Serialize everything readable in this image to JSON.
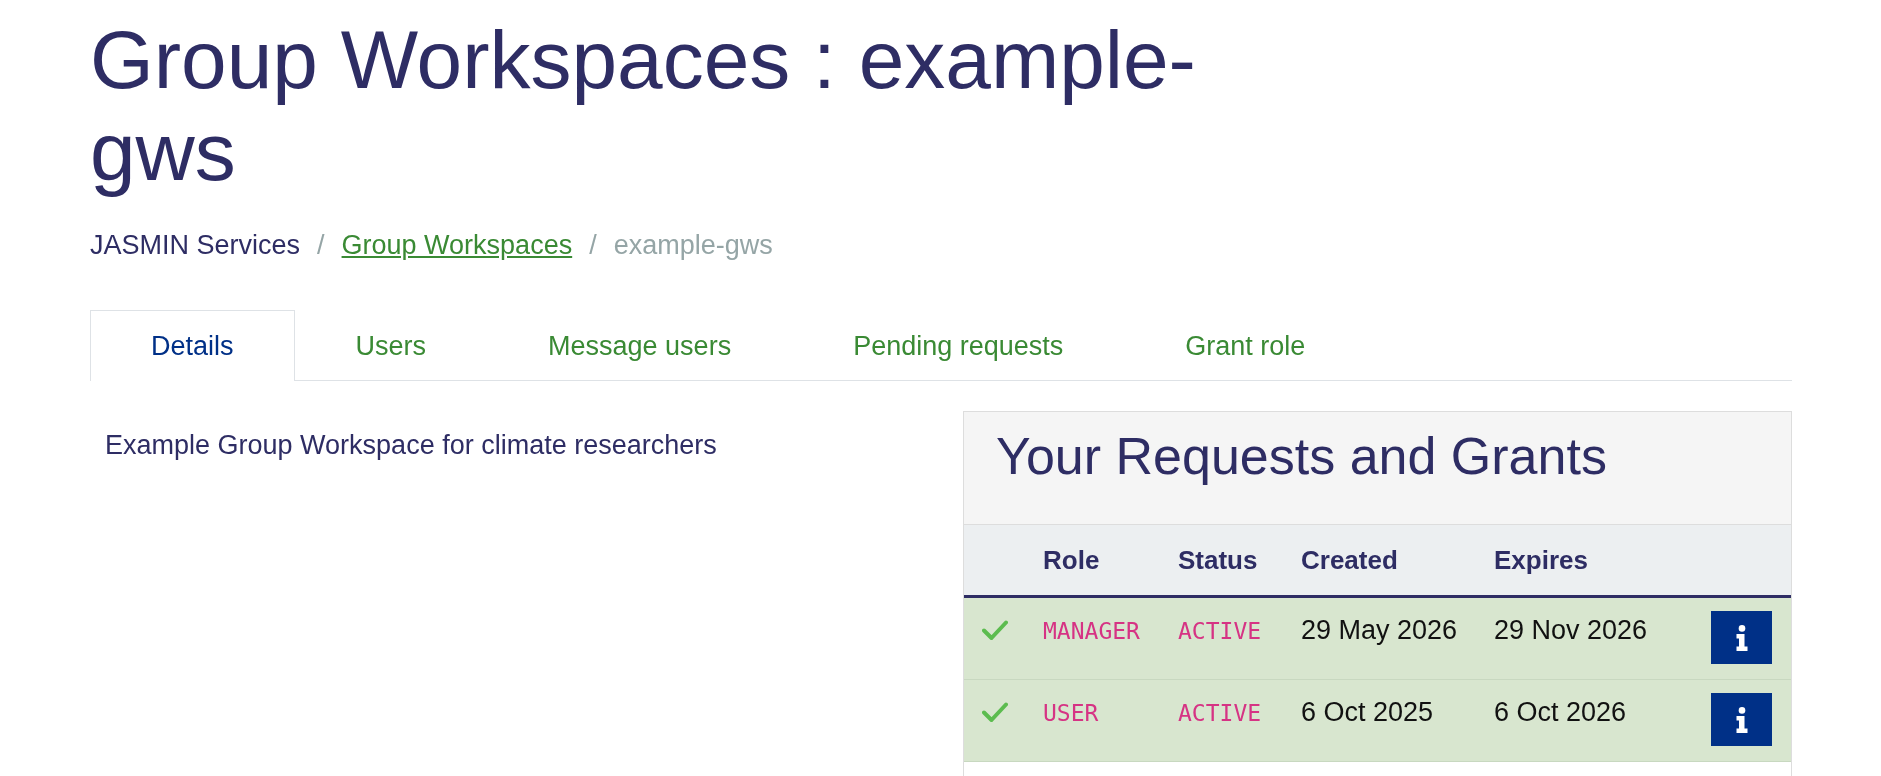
{
  "title": "Group Workspaces : example-gws",
  "breadcrumbs": [
    {
      "kind": "text",
      "label": "JASMIN Services"
    },
    {
      "kind": "separator",
      "label": "/"
    },
    {
      "kind": "link",
      "label": "Group Workspaces"
    },
    {
      "kind": "separator",
      "label": "/"
    },
    {
      "kind": "current",
      "label": "example-gws"
    }
  ],
  "tabs": [
    {
      "label": "Details",
      "selected": true
    },
    {
      "label": "Users",
      "selected": false
    },
    {
      "label": "Message users",
      "selected": false
    },
    {
      "label": "Pending requests",
      "selected": false
    },
    {
      "label": "Grant role",
      "selected": false
    }
  ],
  "description": "Example Group Workspace for climate researchers",
  "requests_panel": {
    "title": "Your Requests and Grants",
    "table": {
      "columns": [
        "Role",
        "Status",
        "Created",
        "Expires"
      ],
      "rows": [
        {
          "granted": true,
          "role": "MANAGER",
          "status": "ACTIVE",
          "created": "29 May 2026",
          "expires": "29 Nov 2026"
        },
        {
          "granted": true,
          "role": "USER",
          "status": "ACTIVE",
          "created": "6 Oct 2025",
          "expires": "6 Oct 2026"
        }
      ]
    }
  }
}
